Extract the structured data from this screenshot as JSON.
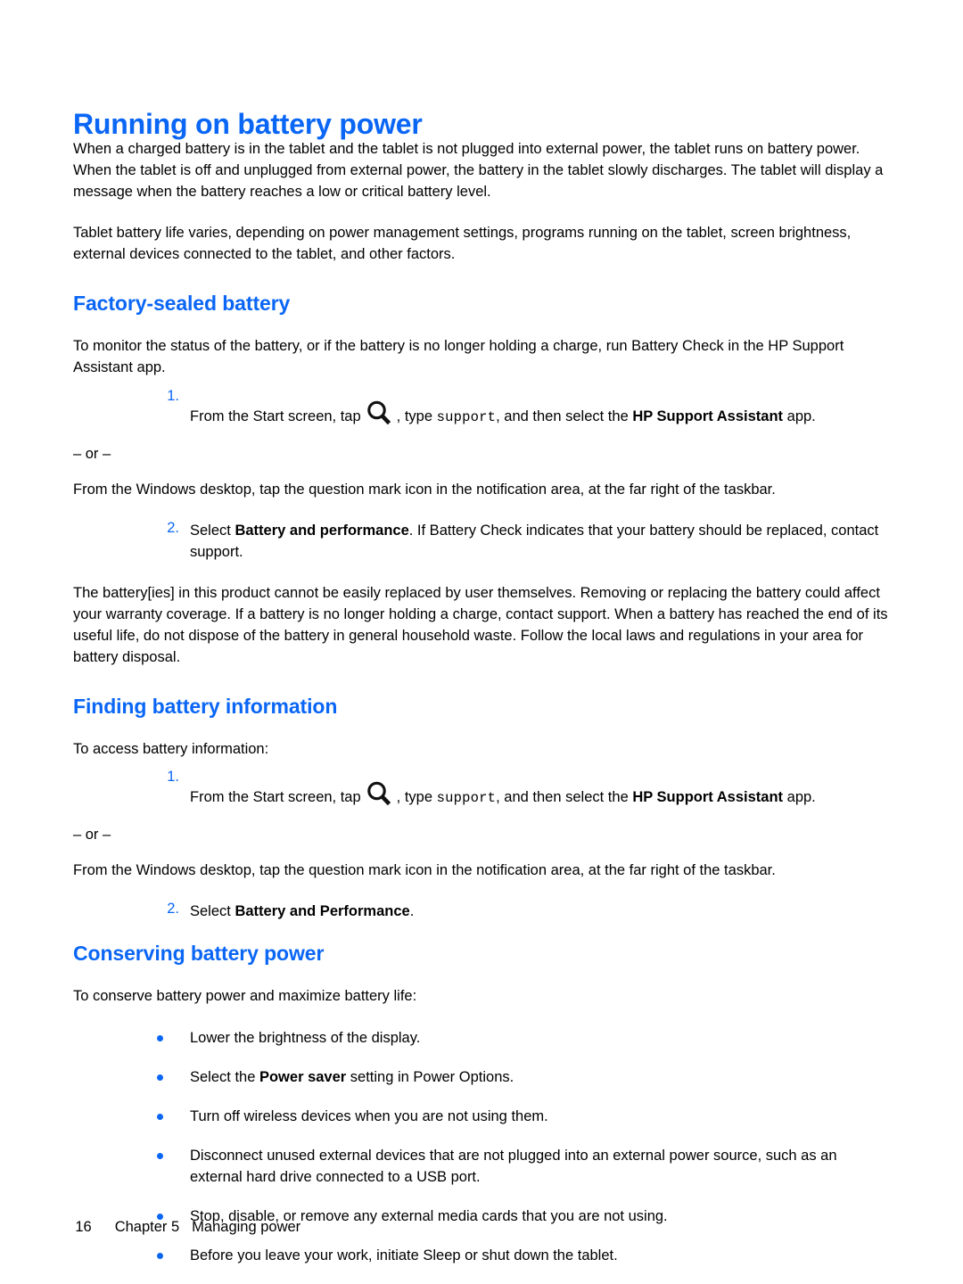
{
  "page": {
    "title": "Running on battery power",
    "intro_paragraphs": [
      "When a charged battery is in the tablet and the tablet is not plugged into external power, the tablet runs on battery power. When the tablet is off and unplugged from external power, the battery in the tablet slowly discharges. The tablet will display a message when the battery reaches a low or critical battery level.",
      "Tablet battery life varies, depending on power management settings, programs running on the tablet, screen brightness, external devices connected to the tablet, and other factors."
    ]
  },
  "factory_sealed": {
    "heading": "Factory-sealed battery",
    "intro": "To monitor the status of the battery, or if the battery is no longer holding a charge, run Battery Check in the HP Support Assistant app.",
    "step1": {
      "number": "1.",
      "text_before_icon": "From the Start screen, tap",
      "icon": "search-icon",
      "text_after_icon": ", type",
      "mono_text": "support",
      "text_after_mono": ", and then select the",
      "bold_app": "HP Support Assistant",
      "text_end": "app."
    },
    "or_label": "– or –",
    "alternative": "From the Windows desktop, tap the question mark icon in the notification area, at the far right of the taskbar.",
    "step2": {
      "number": "2.",
      "text_before_bold": "Select",
      "bold_text": "Battery and performance",
      "text_after_bold": ". If Battery Check indicates that your battery should be replaced, contact support."
    },
    "closing": "The battery[ies] in this product cannot be easily replaced by user themselves. Removing or replacing the battery could affect your warranty coverage. If a battery is no longer holding a charge, contact support. When a battery has reached the end of its useful life, do not dispose of the battery in general household waste. Follow the local laws and regulations in your area for battery disposal."
  },
  "finding_info": {
    "heading": "Finding battery information",
    "intro": "To access battery information:",
    "step1": {
      "number": "1.",
      "text_before_icon": "From the Start screen, tap",
      "icon": "search-icon",
      "text_after_icon": ", type",
      "mono_text": "support",
      "text_after_mono": ", and then select the",
      "bold_app": "HP Support Assistant",
      "text_end": "app."
    },
    "or_label": "– or –",
    "alternative": "From the Windows desktop, tap the question mark icon in the notification area, at the far right of the taskbar.",
    "step2": {
      "number": "2.",
      "text_before_bold": "Select",
      "bold_text": "Battery and Performance",
      "text_after_bold": "."
    }
  },
  "conserving": {
    "heading": "Conserving battery power",
    "intro": "To conserve battery power and maximize battery life:",
    "bullets": [
      {
        "pre": "Lower the brightness of the display.",
        "bold": "",
        "post": ""
      },
      {
        "pre": "Select the ",
        "bold": "Power saver",
        "post": " setting in Power Options."
      },
      {
        "pre": "Turn off wireless devices when you are not using them.",
        "bold": "",
        "post": ""
      },
      {
        "pre": "Disconnect unused external devices that are not plugged into an external power source, such as an external hard drive connected to a USB port.",
        "bold": "",
        "post": ""
      },
      {
        "pre": "Stop, disable, or remove any external media cards that you are not using.",
        "bold": "",
        "post": ""
      },
      {
        "pre": "Before you leave your work, initiate Sleep or shut down the tablet.",
        "bold": "",
        "post": ""
      }
    ]
  },
  "footer": {
    "page_number": "16",
    "chapter": "Chapter 5",
    "chapter_title": "Managing power"
  },
  "colors": {
    "heading_blue": "#0a66f5",
    "text_black": "#000000",
    "background": "#ffffff"
  }
}
